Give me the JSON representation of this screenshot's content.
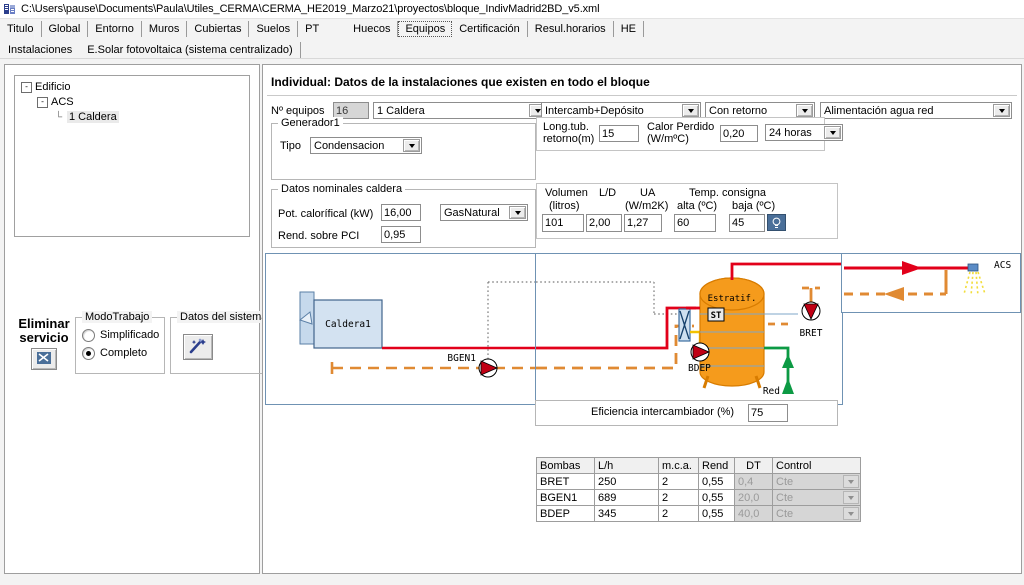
{
  "window": {
    "icon": "app-icon",
    "path": "C:\\Users\\pause\\Documents\\Paula\\Utiles_CERMA\\CERMA_HE2019_Marzo21\\proyectos\\bloque_IndivMadrid2BD_v5.xml"
  },
  "main_tabs": [
    {
      "label": "Titulo",
      "selected": false
    },
    {
      "label": "Global",
      "selected": false
    },
    {
      "label": "Entorno",
      "selected": false
    },
    {
      "label": "Muros",
      "selected": false
    },
    {
      "label": "Cubiertas",
      "selected": false
    },
    {
      "label": "Suelos",
      "selected": false
    },
    {
      "label": "PT",
      "selected": false
    },
    {
      "label": "Huecos",
      "selected": false
    },
    {
      "label": "Equipos",
      "selected": true
    },
    {
      "label": "Certificación",
      "selected": false
    },
    {
      "label": "Resul.horarios",
      "selected": false
    },
    {
      "label": "HE",
      "selected": false
    }
  ],
  "sub_tabs": [
    {
      "label": "Instalaciones",
      "selected": true
    },
    {
      "label": "E.Solar fotovoltaica (sistema centralizado)",
      "selected": false
    }
  ],
  "tree": {
    "root": {
      "label": "Edificio",
      "expander": "-"
    },
    "child": {
      "label": "ACS",
      "expander": "-"
    },
    "leaf": {
      "label": "1 Caldera",
      "selected": true
    }
  },
  "left_controls": {
    "eliminar_line1": "Eliminar",
    "eliminar_line2": "servicio",
    "eliminar_icon": "delete-service-icon",
    "modo_trabajo": {
      "title": "ModoTrabajo",
      "options": [
        {
          "label": "Simplificado",
          "selected": false
        },
        {
          "label": "Completo",
          "selected": true
        }
      ]
    },
    "datos_sistema": {
      "title": "Datos del sistema",
      "icon": "magic-wand-icon"
    }
  },
  "panel": {
    "header": "Individual: Datos de la instalaciones que existen en todo el bloque",
    "n_equipos_label": "Nº equipos",
    "n_equipos_value": "16",
    "combo_equipos": "1 Caldera",
    "combo_sistema": "Intercamb+Depósito",
    "combo_retorno": "Con retorno",
    "combo_alimentacion": "Alimentación agua red"
  },
  "generador": {
    "title": "Generador1",
    "tipo_label": "Tipo",
    "tipo_value": "Condensacion"
  },
  "datos_caldera": {
    "title": "Datos nominales caldera",
    "pot_label": "Pot. calorífical (kW)",
    "pot_value": "16,00",
    "combustible": "GasNatural",
    "rend_label": "Rend. sobre PCI",
    "rend_value": "0,95"
  },
  "retorno": {
    "long_label_l1": "Long.tub.",
    "long_label_l2": "retorno(m)",
    "long_value": "15",
    "calor_label_l1": "Calor Perdido",
    "calor_label_l2": "(W/mºC)",
    "calor_value": "0,20",
    "horas_value": "24 horas"
  },
  "deposito": {
    "vol_l1": "Volumen",
    "vol_l2": "(litros)",
    "ld_label": "L/D",
    "ua_l1": "UA",
    "ua_l2": "(W/m2K)",
    "temp_title": "Temp. consigna",
    "alta_label": "alta (ºC)",
    "baja_label": "baja (ºC)",
    "vol_value": "101",
    "ld_value": "2,00",
    "ua_value": "1,27",
    "alta_value": "60",
    "baja_value": "45",
    "bulb_icon": "lightbulb-icon"
  },
  "diagram": {
    "caldera_label": "Caldera1",
    "bgen_label": "BGEN1",
    "bdep_label": "BDEP",
    "bret_label": "BRET",
    "tank_label": "Estratif.",
    "tank_badge": "ST",
    "red_label": "Red",
    "acs_label": "ACS",
    "colors": {
      "hot_flow": "#e2001a",
      "return_flow": "#e08a33",
      "tank_fill": "#f59b1c",
      "cold_water": "#13a049",
      "panel_border": "#6f92b3"
    }
  },
  "eficiencia": {
    "label": "Eficiencia intercambiador (%)",
    "value": "75"
  },
  "pumps_table": {
    "headers": [
      "Bombas",
      "L/h",
      "m.c.a.",
      "Rend",
      "DT",
      "Control"
    ],
    "rows": [
      {
        "bomba": "BRET",
        "lh": "250",
        "mca": "2",
        "rend": "0,55",
        "dt": "0,4",
        "control": "Cte"
      },
      {
        "bomba": "BGEN1",
        "lh": "689",
        "mca": "2",
        "rend": "0,55",
        "dt": "20,0",
        "control": "Cte"
      },
      {
        "bomba": "BDEP",
        "lh": "345",
        "mca": "2",
        "rend": "0,55",
        "dt": "40,0",
        "control": "Cte"
      }
    ]
  }
}
